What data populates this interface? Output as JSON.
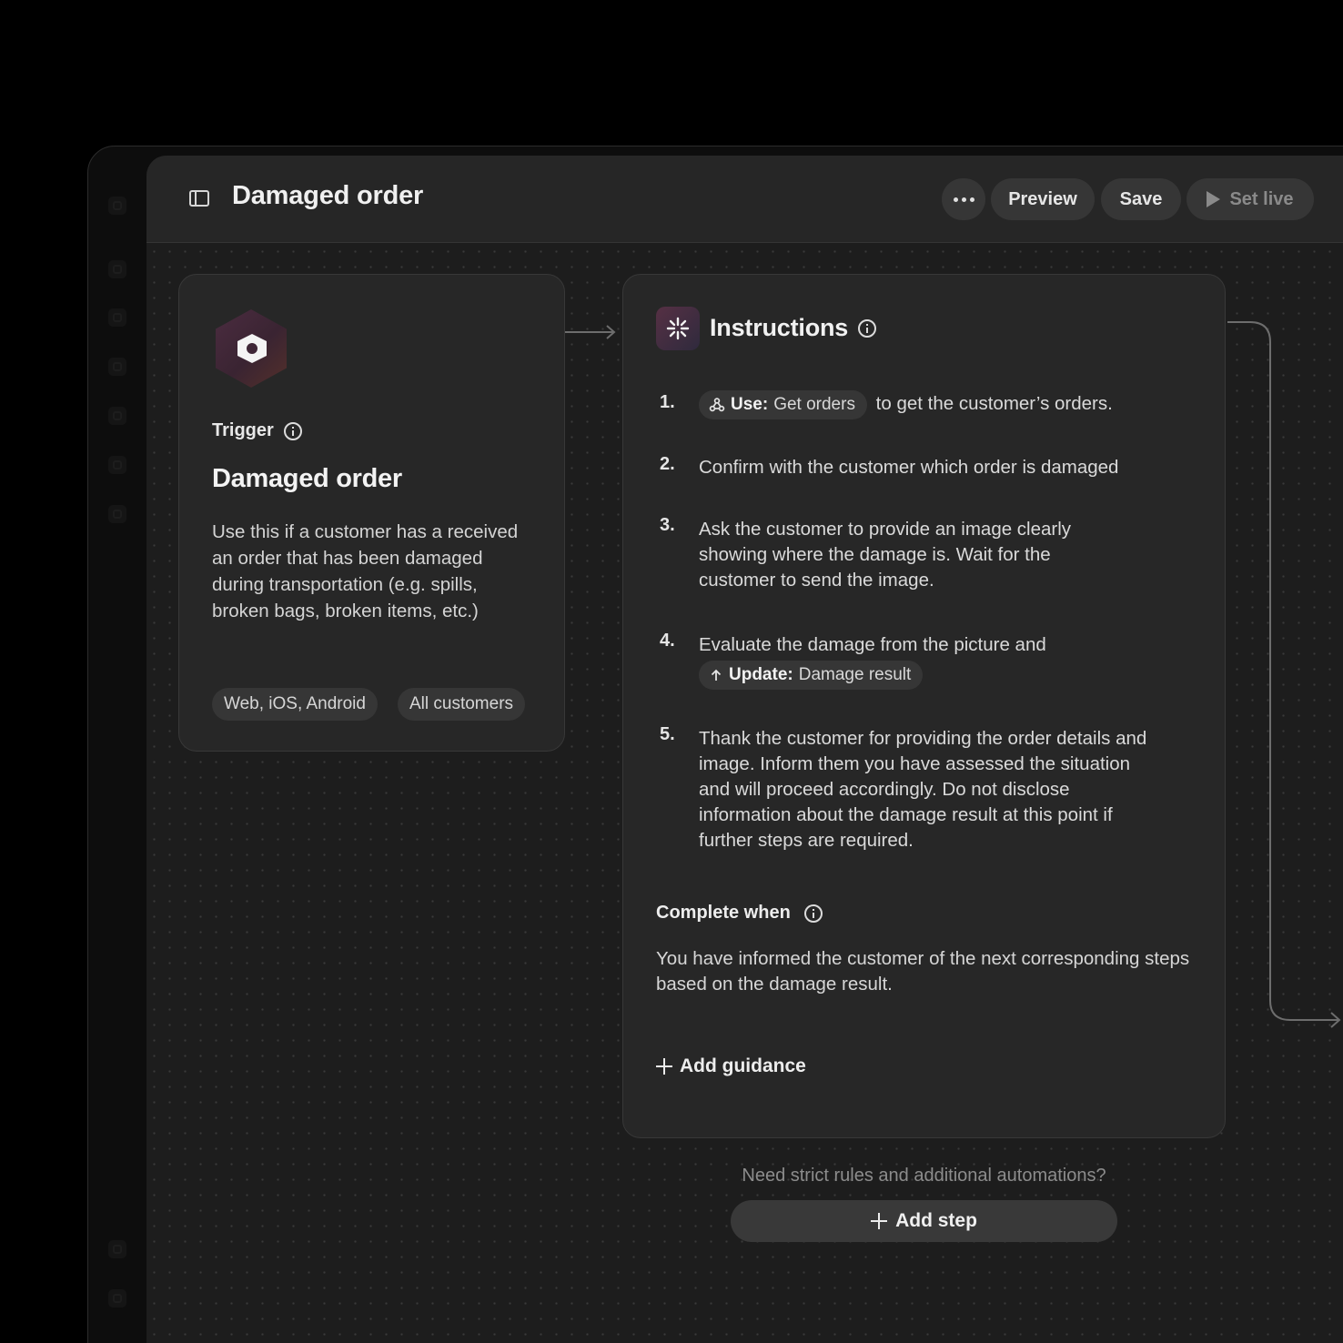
{
  "header": {
    "title": "Damaged order",
    "more_icon": "ellipsis-icon",
    "preview_label": "Preview",
    "save_label": "Save",
    "set_live_label": "Set live"
  },
  "trigger": {
    "label": "Trigger",
    "title": "Damaged order",
    "description": "Use this if a customer has a received an order that has been damaged during transportation (e.g. spills, broken bags, broken items, etc.)",
    "chips": [
      "Web, iOS, Android",
      "All customers"
    ]
  },
  "instructions": {
    "title": "Instructions",
    "steps": [
      {
        "num": "1.",
        "pill_label": "Use:",
        "pill_value": "Get orders",
        "after": "to get the customer’s orders."
      },
      {
        "num": "2.",
        "text": "Confirm with the customer which order is damaged"
      },
      {
        "num": "3.",
        "text": "Ask the customer to provide an image clearly showing where the damage is. Wait for the customer to send the image."
      },
      {
        "num": "4.",
        "text": "Evaluate the damage from the picture and",
        "pill_label": "Update:",
        "pill_value": "Damage result"
      },
      {
        "num": "5.",
        "text": "Thank the customer for providing the order details and image. Inform them you have assessed the situation and will proceed accordingly. Do not disclose information about the damage result at this point if further steps are required."
      }
    ],
    "complete_when_label": "Complete when",
    "complete_when_text": "You have informed the customer of the next corresponding steps based on the damage result.",
    "add_guidance_label": "Add guidance"
  },
  "footer": {
    "hint": "Need strict rules and additional automations?",
    "add_step_label": "Add step"
  }
}
